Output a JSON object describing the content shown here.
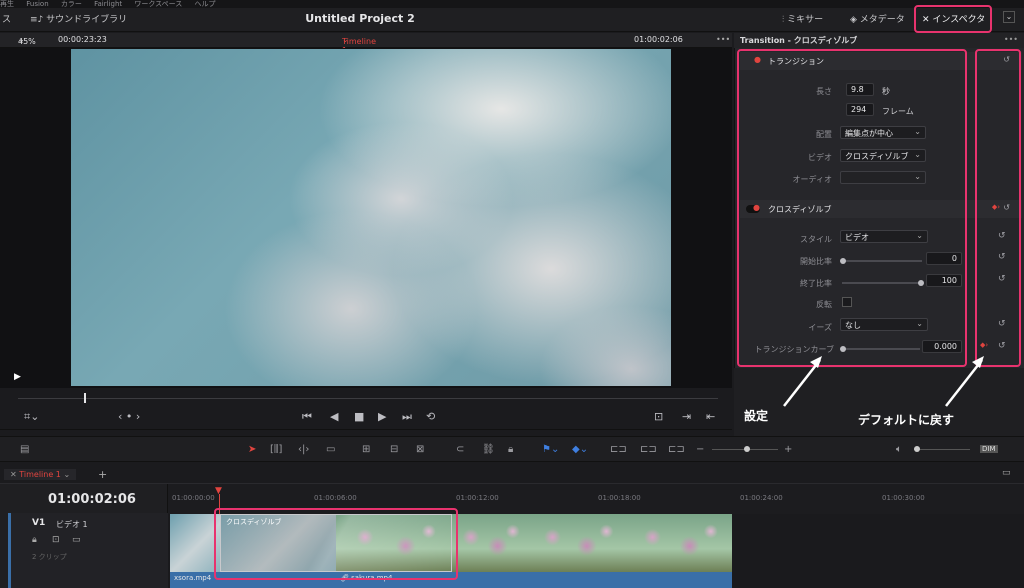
{
  "menu": [
    "再生",
    "Fusion",
    "カラー",
    "Fairlight",
    "ワークスペース",
    "ヘルプ"
  ],
  "topbar": {
    "left_label": "ス",
    "sound_library": "サウンドライブラリ",
    "project_title": "Untitled Project 2",
    "mixer": "ミキサー",
    "metadata": "メタデータ",
    "inspector": "インスペクタ"
  },
  "viewer": {
    "zoom": "45%",
    "source_timecode": "00:00:23:23",
    "timeline_name": "Timeline 1",
    "record_timecode": "01:00:02:06"
  },
  "inspector": {
    "title": "Transition - クロスディゾルブ",
    "transition_section": "トランジション",
    "duration_label": "長さ",
    "duration_seconds": "9.8",
    "seconds_unit": "秒",
    "duration_frames": "294",
    "frames_unit": "フレーム",
    "alignment_label": "配置",
    "alignment_value": "編集点が中心",
    "video_label": "ビデオ",
    "video_value": "クロスディゾルブ",
    "audio_label": "オーディオ",
    "dissolve_section": "クロスディゾルブ",
    "style_label": "スタイル",
    "style_value": "ビデオ",
    "start_ratio_label": "開始比率",
    "start_ratio_value": "0",
    "end_ratio_label": "終了比率",
    "end_ratio_value": "100",
    "reverse_label": "反転",
    "ease_label": "イーズ",
    "ease_value": "なし",
    "curve_label": "トランジションカーブ",
    "curve_value": "0.000"
  },
  "annotations": {
    "settings": "設定",
    "reset_default": "デフォルトに戻す"
  },
  "timeline": {
    "tab_name": "Timeline 1",
    "timecode": "01:00:02:06",
    "track_name": "V1",
    "track_label": "ビデオ 1",
    "clip_count": "2 クリップ",
    "ruler": [
      "01:00:00:00",
      "01:00:06:00",
      "01:00:12:00",
      "01:00:18:00",
      "01:00:24:00",
      "01:00:30:00"
    ],
    "clip1_name": "xsora.mp4",
    "clip2_name": "sakura.mp4",
    "transition_name": "クロスディゾルブ"
  },
  "colors": {
    "highlight": "#e8336e",
    "timeline_red": "#e0443f",
    "audio_clip": "#3a6fa8"
  },
  "icons": [
    "mixer-icon",
    "metadata-icon",
    "inspector-icon",
    "play-icon",
    "stop-icon",
    "loop-icon",
    "reset-icon",
    "keyframe-icon",
    "snap-icon",
    "link-icon",
    "lock-icon",
    "flag-icon",
    "speaker-icon"
  ]
}
